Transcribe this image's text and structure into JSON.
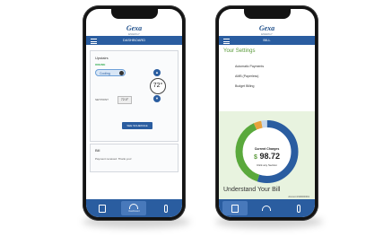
{
  "brand": {
    "logo": "Gexa",
    "tagline": "ENERGY"
  },
  "left_phone": {
    "nav_title": "DASHBOARD",
    "thermostat": {
      "title": "Upstairs",
      "status": "ONLINE",
      "mode": "Cooling",
      "temperature": "72°",
      "setpoint_label": "SETPOINT",
      "setpoint_value": "72.0°",
      "schedule_button": "SEE SCHEDULE"
    },
    "bill_card": {
      "title": "Bill",
      "message": "Payment received. Thank you!"
    },
    "tabs": [
      "",
      "Dashboard",
      ""
    ]
  },
  "right_phone": {
    "nav_title": "BILL",
    "settings_title": "Your Settings",
    "settings_items": [
      "Automatic Payments",
      "AMB (Paperless)",
      "Budget Billing"
    ],
    "donut": {
      "label": "Current Charges",
      "currency": "$",
      "amount": "98.72",
      "hint": "Click any Section",
      "segments": [
        {
          "color": "#2a5da0",
          "fraction": 0.55
        },
        {
          "color": "#5aa93c",
          "fraction": 0.38
        },
        {
          "color": "#e8a23c",
          "fraction": 0.04
        },
        {
          "color": "#c6d7ea",
          "fraction": 0.03
        }
      ]
    },
    "understand_title": "Understand Your Bill",
    "account_line1": "Account #100000001",
    "account_line2": "May 11, 2022",
    "tabs": [
      "",
      "",
      ""
    ]
  }
}
